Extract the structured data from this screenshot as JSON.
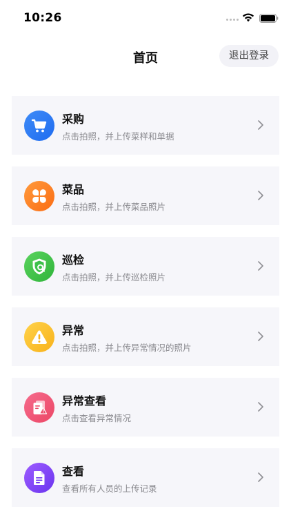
{
  "status_bar": {
    "time": "10:26"
  },
  "header": {
    "title": "首页",
    "logout_label": "退出登录"
  },
  "menu": {
    "items": [
      {
        "title": "采购",
        "desc": "点击拍照，并上传菜样和单据",
        "icon": "cart-icon",
        "color": "#2f7cf6"
      },
      {
        "title": "菜品",
        "desc": "点击拍照，并上传菜品照片",
        "icon": "clover-icon",
        "color": "#fb7d22"
      },
      {
        "title": "巡检",
        "desc": "点击拍照，并上传巡检照片",
        "icon": "shield-search-icon",
        "color": "#3cc14a"
      },
      {
        "title": "异常",
        "desc": "点击拍照，并上传异常情况的照片",
        "icon": "warning-icon",
        "color": "#fbc02d"
      },
      {
        "title": "异常查看",
        "desc": "点击查看异常情况",
        "icon": "alert-document-icon",
        "color": "#ef5676"
      },
      {
        "title": "查看",
        "desc": "查看所有人员的上传记录",
        "icon": "document-icon",
        "color": "#7d45f6"
      }
    ]
  }
}
